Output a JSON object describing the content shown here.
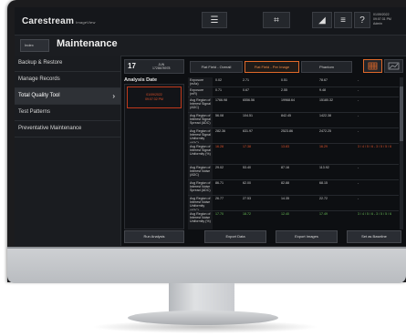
{
  "app": {
    "brand": "Carestream",
    "brand_sub": "ImageView"
  },
  "topbar": {
    "icons": [
      {
        "name": "list-icon",
        "glyph": "☰"
      },
      {
        "name": "exposure-icon",
        "glyph": "⌗"
      },
      {
        "name": "signal-icon",
        "glyph": "◢"
      },
      {
        "name": "menu-icon",
        "glyph": "≡"
      },
      {
        "name": "help-icon",
        "glyph": "?"
      }
    ],
    "clock_line1": "01/09/2022",
    "clock_line2": "09:07:31 PM",
    "clock_line3": "Admin"
  },
  "titlebar": {
    "home_label": "Index",
    "title": "Maintenance"
  },
  "sidebar": {
    "items": [
      {
        "label": "Backup & Restore"
      },
      {
        "label": "Manage Records"
      },
      {
        "label": "Total Quality Tool"
      },
      {
        "label": "Test Patterns"
      },
      {
        "label": "Preventative Maintenance"
      }
    ]
  },
  "main": {
    "date_day": "17",
    "date_line1": "JUN",
    "date_line2": "1728678978",
    "tabs": [
      {
        "label": "Flat Field - Overall"
      },
      {
        "label": "Flat Field - Per Image"
      },
      {
        "label": "Phantom"
      }
    ],
    "analysis_label": "Analysis Date",
    "analysis_entry_line1": "01/09/2022",
    "analysis_entry_line2": "09:07:32 PM",
    "buttons": [
      {
        "label": "Run Analysis"
      },
      {
        "label": "Export Data"
      },
      {
        "label": "Export Images"
      },
      {
        "label": "Set as Baseline"
      }
    ]
  },
  "table": {
    "rows": [
      {
        "label": "Exposure (mAs)",
        "cells": [
          "0.02",
          "2.71",
          "0.51",
          "78.67",
          "-"
        ]
      },
      {
        "label": "Exposure (mR)",
        "cells": [
          "0.71",
          "0.67",
          "2.55",
          "9.48",
          "-"
        ]
      },
      {
        "label": "Avg Region of Interest Signal (ADC)",
        "cells": [
          "1766.98",
          "6556.56",
          "19968.64",
          "15180.32",
          "-"
        ]
      },
      {
        "label": "Avg Region of Interest Signal Spread (ADC)",
        "cells": [
          "56.08",
          "104.51",
          "842.45",
          "1422.38",
          "-"
        ]
      },
      {
        "label": "Avg Region of Interest Signal Uniformity (ADC)",
        "cells": [
          "282.36",
          "631.97",
          "2523.86",
          "2472.25",
          "-"
        ]
      },
      {
        "label": "Avg Region of Interest Signal Uniformity (%)",
        "cells": [
          "16.28",
          "17.38",
          "13.83",
          "16.29",
          "3 / 4 / 5 / 6 - 3 / 5 / 5 / 6"
        ],
        "status": "red"
      },
      {
        "label": "Avg Region of Interest Noise (ADC)",
        "cells": [
          "29.02",
          "53.40",
          "87.16",
          "113.92",
          "-"
        ]
      },
      {
        "label": "Avg Region of Interest Noise Spread (ADC)",
        "cells": [
          "86.71",
          "62.00",
          "82.88",
          "68.15",
          "-"
        ]
      },
      {
        "label": "Avg Region of Interest Noise Uniformity (ADC)",
        "cells": [
          "26.77",
          "27.53",
          "14.35",
          "22.72",
          "-"
        ]
      },
      {
        "label": "Avg Region of Interest Noise Uniformity (%)",
        "cells": [
          "17.70",
          "18.72",
          "12.40",
          "17.49",
          "3 / 4 / 5 / 6 - 3 / 5 / 5 / 6"
        ],
        "status": "green"
      },
      {
        "label": "Avg Region of",
        "cells": [
          "",
          "",
          "",
          "",
          ""
        ]
      }
    ]
  }
}
